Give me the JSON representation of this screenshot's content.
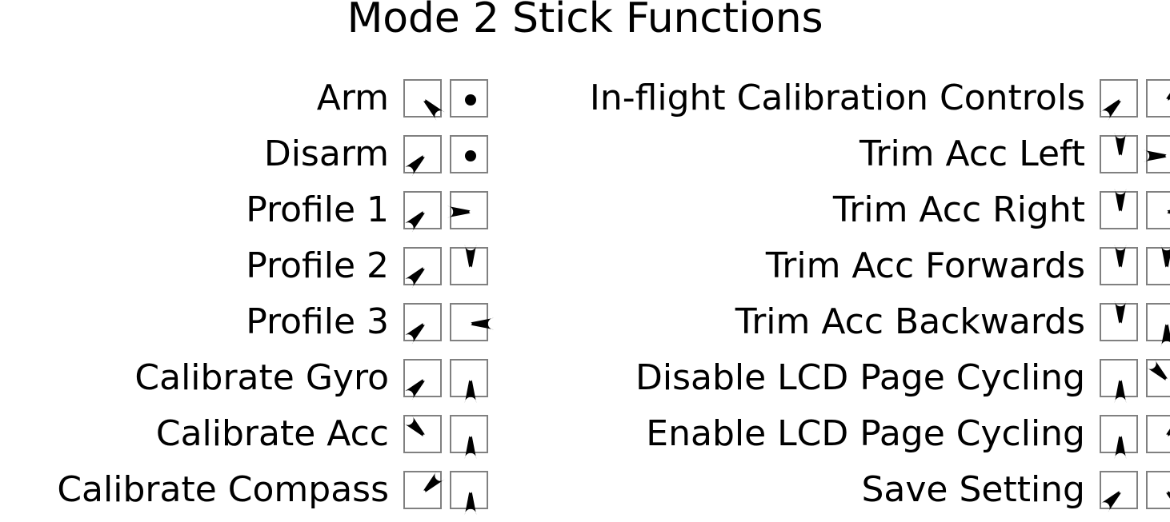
{
  "title": "Mode 2 Stick Functions",
  "columns": {
    "left": {
      "rows": [
        {
          "label": "Arm",
          "left_stick": "down-right",
          "right_stick": "center"
        },
        {
          "label": "Disarm",
          "left_stick": "down-left",
          "right_stick": "center"
        },
        {
          "label": "Profile 1",
          "left_stick": "down-left",
          "right_stick": "left"
        },
        {
          "label": "Profile 2",
          "left_stick": "down-left",
          "right_stick": "up"
        },
        {
          "label": "Profile 3",
          "left_stick": "down-left",
          "right_stick": "right"
        },
        {
          "label": "Calibrate Gyro",
          "left_stick": "down-left",
          "right_stick": "down"
        },
        {
          "label": "Calibrate Acc",
          "left_stick": "up-left",
          "right_stick": "down"
        },
        {
          "label": "Calibrate Compass",
          "left_stick": "up-right",
          "right_stick": "down"
        }
      ]
    },
    "right": {
      "rows": [
        {
          "label": "In-flight Calibration Controls",
          "left_stick": "down-left",
          "right_stick": "up-right"
        },
        {
          "label": "Trim Acc Left",
          "left_stick": "up",
          "right_stick": "left"
        },
        {
          "label": "Trim Acc Right",
          "left_stick": "up",
          "right_stick": "right"
        },
        {
          "label": "Trim Acc Forwards",
          "left_stick": "up",
          "right_stick": "up"
        },
        {
          "label": "Trim Acc Backwards",
          "left_stick": "up",
          "right_stick": "down"
        },
        {
          "label": "Disable LCD Page Cycling",
          "left_stick": "down",
          "right_stick": "up-left"
        },
        {
          "label": "Enable LCD Page Cycling",
          "left_stick": "down",
          "right_stick": "up-right"
        },
        {
          "label": "Save Setting",
          "left_stick": "down-left",
          "right_stick": "down-right"
        }
      ]
    }
  },
  "style": {
    "background": "#ffffff",
    "text_color": "#000000",
    "box_border_color": "#808080",
    "stick_color": "#000000"
  },
  "icon_names": {
    "center": "stick-center-icon",
    "up": "stick-up-icon",
    "down": "stick-down-icon",
    "left": "stick-left-icon",
    "right": "stick-right-icon",
    "up-left": "stick-up-left-icon",
    "up-right": "stick-up-right-icon",
    "down-left": "stick-down-left-icon",
    "down-right": "stick-down-right-icon"
  }
}
